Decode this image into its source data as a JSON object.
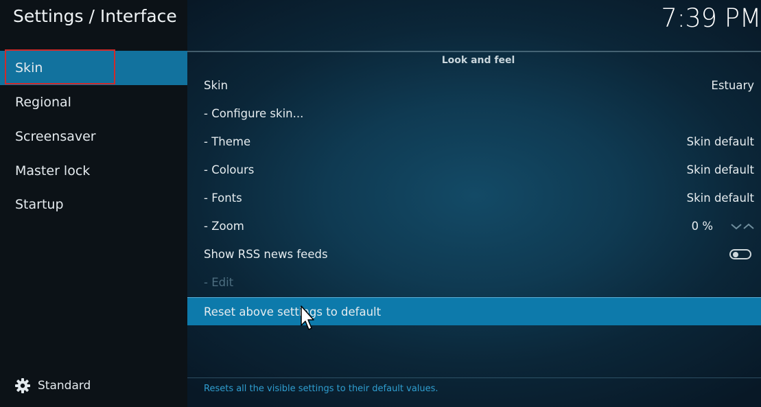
{
  "header": {
    "title": "Settings / Interface",
    "clock": "7:39 PM"
  },
  "sidebar": {
    "items": [
      {
        "label": "Skin",
        "selected": true
      },
      {
        "label": "Regional"
      },
      {
        "label": "Screensaver"
      },
      {
        "label": "Master lock"
      },
      {
        "label": "Startup"
      }
    ],
    "mode_label": "Standard",
    "mode_icon": "gear-icon"
  },
  "main": {
    "section_title": "Look and feel",
    "settings": [
      {
        "label": "Skin",
        "value": "Estuary"
      },
      {
        "label": "- Configure skin...",
        "value": ""
      },
      {
        "label": "- Theme",
        "value": "Skin default"
      },
      {
        "label": "- Colours",
        "value": "Skin default"
      },
      {
        "label": "- Fonts",
        "value": "Skin default"
      },
      {
        "label": "- Zoom",
        "value": "0 %"
      },
      {
        "label": "Show RSS news feeds",
        "value": "",
        "toggle": false
      },
      {
        "label": "- Edit",
        "value": "",
        "disabled": true
      },
      {
        "label": "Reset above settings to default",
        "value": "",
        "focused": true
      }
    ],
    "help_text": "Resets all the visible settings to their default values."
  },
  "colors": {
    "accent": "#12729e",
    "focus_row": "#0d7aab",
    "selection_outline": "#d12a2a",
    "help_text": "#2f9ed0"
  }
}
